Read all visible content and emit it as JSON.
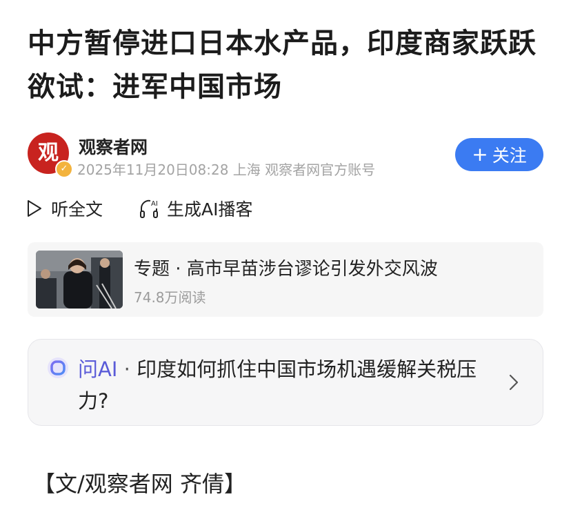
{
  "article": {
    "title": "中方暂停进口日本水产品，印度商家跃跃欲试：进军中国市场"
  },
  "author": {
    "avatar_char": "观",
    "name": "观察者网",
    "meta": "2025年11月20日08:28 上海 观察者网官方账号",
    "follow_label": "关注"
  },
  "actions": {
    "listen_label": "听全文",
    "podcast_label": "生成AI播客",
    "podcast_badge": "AI"
  },
  "topic": {
    "title": "专题 · 高市早苗涉台谬论引发外交风波",
    "reads": "74.8万阅读"
  },
  "ask_ai": {
    "label": "问AI",
    "separator": " · ",
    "question": "印度如何抓住中国市场机遇缓解关税压力?"
  },
  "body": {
    "byline": "【文/观察者网 齐倩】"
  },
  "colors": {
    "accent_blue": "#3b7bf2",
    "ai_purple": "#5a5bd8",
    "brand_red": "#c8231f"
  }
}
